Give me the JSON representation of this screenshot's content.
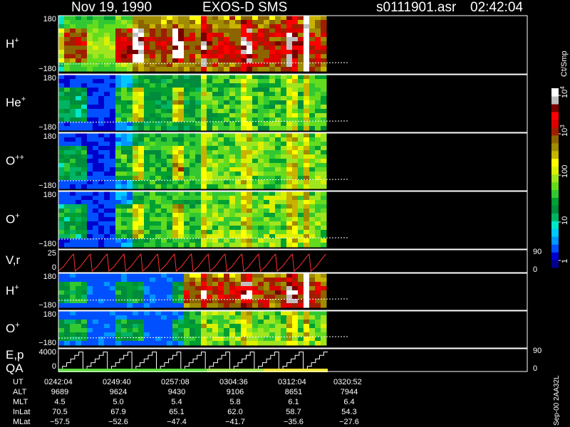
{
  "header": {
    "date": "Nov 19, 1990",
    "instrument": "EXOS-D SMS",
    "file": "s0111901.asr",
    "time": "02:42:04"
  },
  "colorbar": {
    "unit": "Ct/Smp",
    "ticks": [
      "1",
      "10",
      "100",
      "10",
      "10"
    ],
    "tick_sup": [
      "",
      "",
      "",
      "3",
      "4"
    ],
    "colors": [
      "#00008b",
      "#0000cd",
      "#0050ff",
      "#0096ff",
      "#00c8ff",
      "#00e6c8",
      "#00b464",
      "#008c3c",
      "#00a032",
      "#32c832",
      "#64dc1e",
      "#a0e61e",
      "#dcf000",
      "#ffff00",
      "#c8b400",
      "#a08c00",
      "#8c6400",
      "#a01e00",
      "#dc0000",
      "#ff0000",
      "#780000",
      "#c0c0c0",
      "#ffffff"
    ]
  },
  "chart_data": [
    {
      "type": "heatmap",
      "panel": "H+",
      "label": "H",
      "sup": "+",
      "yticks": [
        "180",
        "−180"
      ],
      "ylim": [
        -180,
        180
      ]
    },
    {
      "type": "heatmap",
      "panel": "He+",
      "label": "He",
      "sup": "+",
      "yticks": [
        "180",
        "−180"
      ],
      "ylim": [
        -180,
        180
      ]
    },
    {
      "type": "heatmap",
      "panel": "O++",
      "label": "O",
      "sup": "++",
      "yticks": [
        "180",
        "−180"
      ],
      "ylim": [
        -180,
        180
      ]
    },
    {
      "type": "heatmap",
      "panel": "O+",
      "label": "O",
      "sup": "+",
      "yticks": [
        "180",
        "−180"
      ],
      "ylim": [
        -180,
        180
      ]
    },
    {
      "type": "line",
      "panel": "V,r",
      "label": "V,r",
      "sup": "",
      "yticks": [
        "25",
        "0"
      ],
      "ylim": [
        0,
        25
      ],
      "right_ticks": [
        "90",
        "0"
      ],
      "cycles": 16,
      "series": [
        {
          "values": [
            0,
            2,
            4,
            6,
            9,
            12,
            15,
            18,
            21,
            23
          ]
        }
      ]
    },
    {
      "type": "heatmap",
      "panel": "H+ low",
      "label": "H",
      "sup": "+",
      "yticks": [
        "180",
        "−180"
      ],
      "ylim": [
        -180,
        180
      ]
    },
    {
      "type": "heatmap",
      "panel": "O+ low",
      "label": "O",
      "sup": "+",
      "yticks": [
        "180",
        "−180"
      ],
      "ylim": [
        -180,
        180
      ]
    },
    {
      "type": "line",
      "panel": "E,p QA",
      "label": "E,p",
      "label2": "QA",
      "sup": "",
      "yticks": [
        "4000",
        "0"
      ],
      "ylim": [
        0,
        4000
      ],
      "right_ticks": [
        "90",
        "0"
      ],
      "cycles": 11,
      "series": [
        {
          "values": [
            100,
            800,
            1600,
            2400,
            3200,
            3900
          ]
        }
      ],
      "qa": [
        {
          "from": "0242:04",
          "to": "0304:36",
          "color": "#5adc3c"
        },
        {
          "from": "0304:36",
          "to": "0312:04",
          "color": "#a0e650"
        },
        {
          "from": "0312:04",
          "to": "0320:52",
          "color": "#f0e632"
        }
      ]
    }
  ],
  "table": {
    "rows": [
      {
        "name": "UT",
        "values": [
          "0242:04",
          "0249:40",
          "0257:08",
          "0304:36",
          "0312:04",
          "0320:52"
        ]
      },
      {
        "name": "ALT",
        "values": [
          "9689",
          "9624",
          "9430",
          "9106",
          "8651",
          "7944"
        ]
      },
      {
        "name": "MLT",
        "values": [
          "4.5",
          "5.0",
          "5.4",
          "5.8",
          "6.1",
          "6.4"
        ]
      },
      {
        "name": "InLat",
        "values": [
          "70.5",
          "67.9",
          "65.1",
          "62.0",
          "58.7",
          "54.3"
        ]
      },
      {
        "name": "MLat",
        "values": [
          "−57.5",
          "−52.6",
          "−47.4",
          "−41.7",
          "−35.6",
          "−27.6"
        ]
      }
    ]
  },
  "footer": {
    "code": "Sep-00  2AA32L"
  }
}
